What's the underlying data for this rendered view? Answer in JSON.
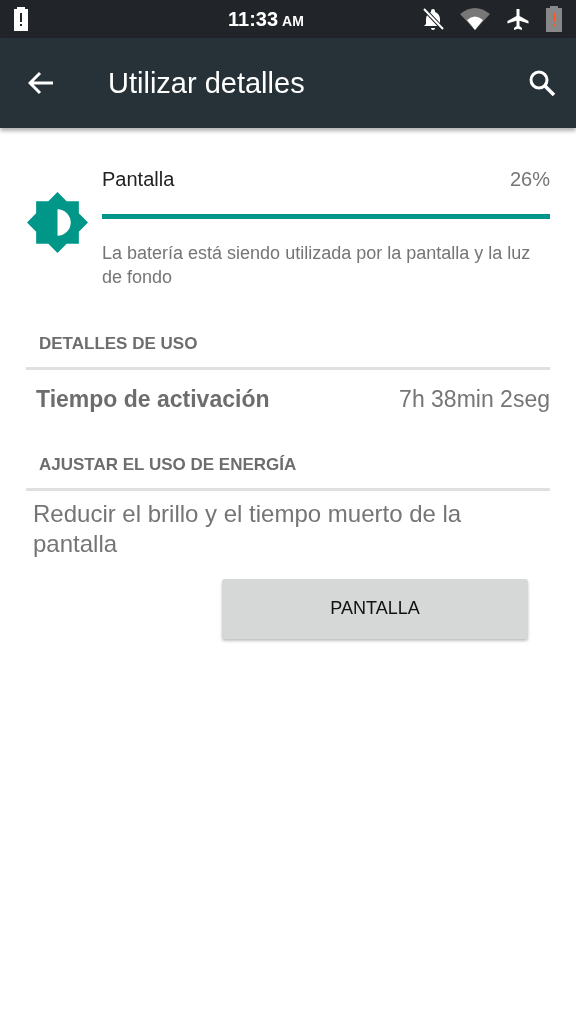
{
  "status_bar": {
    "time": "11:33",
    "ampm": "AM"
  },
  "app_bar": {
    "title": "Utilizar detalles"
  },
  "usage_item": {
    "name": "Pantalla",
    "percent": "26%",
    "level": 1,
    "description": "La batería está siendo utilizada por la pantalla y la luz de fondo"
  },
  "sections": [
    {
      "header": "DETALLES DE USO",
      "kind": "detail",
      "label": "Tiempo de activación",
      "value": "7h 38min 2seg"
    },
    {
      "header": "AJUSTAR EL USO DE ENERGÍA",
      "kind": "action",
      "text": "Reducir el brillo y el tiempo muerto de la pantalla",
      "button": "PANTALLA"
    }
  ]
}
